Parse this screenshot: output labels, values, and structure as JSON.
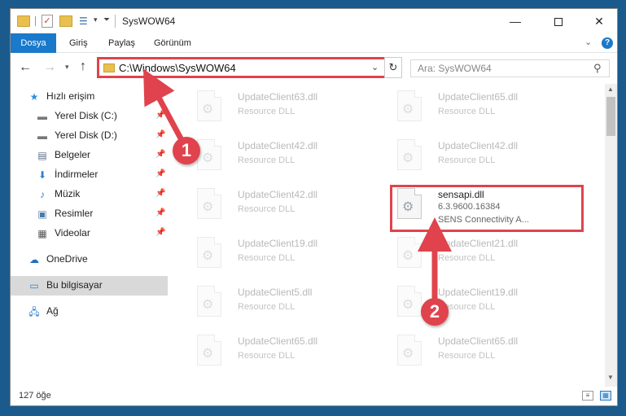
{
  "window": {
    "title": "SysWOW64",
    "min_glyph": "—",
    "close_glyph": "✕"
  },
  "ribbon": {
    "tabs": [
      "Dosya",
      "Giriş",
      "Paylaş",
      "Görünüm"
    ]
  },
  "nav": {
    "address": "C:\\Windows\\SysWOW64",
    "search_placeholder": "Ara: SysWOW64"
  },
  "sidebar": {
    "items": [
      {
        "label": "Hızlı erişim",
        "icon": "star-icon"
      },
      {
        "label": "Yerel Disk (C:)",
        "icon": "drive-icon",
        "pinned": true
      },
      {
        "label": "Yerel Disk (D:)",
        "icon": "drive-icon",
        "pinned": true
      },
      {
        "label": "Belgeler",
        "icon": "documents-icon",
        "pinned": true
      },
      {
        "label": "İndirmeler",
        "icon": "download-icon",
        "pinned": true
      },
      {
        "label": "Müzik",
        "icon": "music-icon",
        "pinned": true
      },
      {
        "label": "Resimler",
        "icon": "pictures-icon",
        "pinned": true
      },
      {
        "label": "Videolar",
        "icon": "videos-icon",
        "pinned": true
      },
      {
        "label": "OneDrive",
        "icon": "cloud-icon"
      },
      {
        "label": "Bu bilgisayar",
        "icon": "computer-icon",
        "selected": true
      },
      {
        "label": "Ağ",
        "icon": "network-icon"
      }
    ]
  },
  "files": {
    "left": [
      {
        "name": "UpdateClient63.dll",
        "desc": "Resource DLL"
      },
      {
        "name": "UpdateClient42.dll",
        "desc": "Resource DLL"
      },
      {
        "name": "UpdateClient42.dll",
        "desc": "Resource DLL"
      },
      {
        "name": "UpdateClient19.dll",
        "desc": "Resource DLL"
      },
      {
        "name": "UpdateClient5.dll",
        "desc": "Resource DLL"
      },
      {
        "name": "UpdateClient65.dll",
        "desc": "Resource DLL"
      }
    ],
    "right": [
      {
        "name": "UpdateClient65.dll",
        "desc": "Resource DLL"
      },
      {
        "name": "UpdateClient42.dll",
        "desc": "Resource DLL"
      },
      {
        "name": "UpdateClient21.dll",
        "desc": "Resource DLL"
      },
      {
        "name": "UpdateClient19.dll",
        "desc": "Resource DLL"
      },
      {
        "name": "UpdateClient65.dll",
        "desc": "Resource DLL"
      }
    ],
    "highlighted": {
      "name": "sensapi.dll",
      "version": "6.3.9600.16384",
      "desc": "SENS Connectivity A..."
    }
  },
  "status": {
    "count": "127 öğe"
  },
  "annotations": {
    "step1": "1",
    "step2": "2",
    "color": "#e0434d"
  }
}
